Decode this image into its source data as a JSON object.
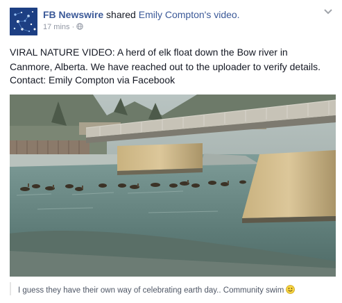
{
  "post": {
    "author": "FB Newswire",
    "action": " shared ",
    "shared_from": "Emily Compton's video.",
    "time": "17 mins",
    "separator": " · ",
    "text_line1": "VIRAL NATURE VIDEO: A herd of elk float down the Bow river in",
    "text_line2": "Canmore, Alberta. We have reached out to the uploader to verify details.",
    "contact": "Contact: Emily Compton via Facebook",
    "video_caption": "I guess they have their own way of celebrating earth day.. Community swim",
    "icons": {
      "avatar": "newswire-logo",
      "privacy": "globe-icon",
      "menu": "chevron-down-icon",
      "emoji": "smiley-emoji"
    }
  },
  "colors": {
    "link": "#3b5998",
    "meta": "#9197a3",
    "text": "#141823",
    "avatar_bg": "#1d3f83"
  }
}
